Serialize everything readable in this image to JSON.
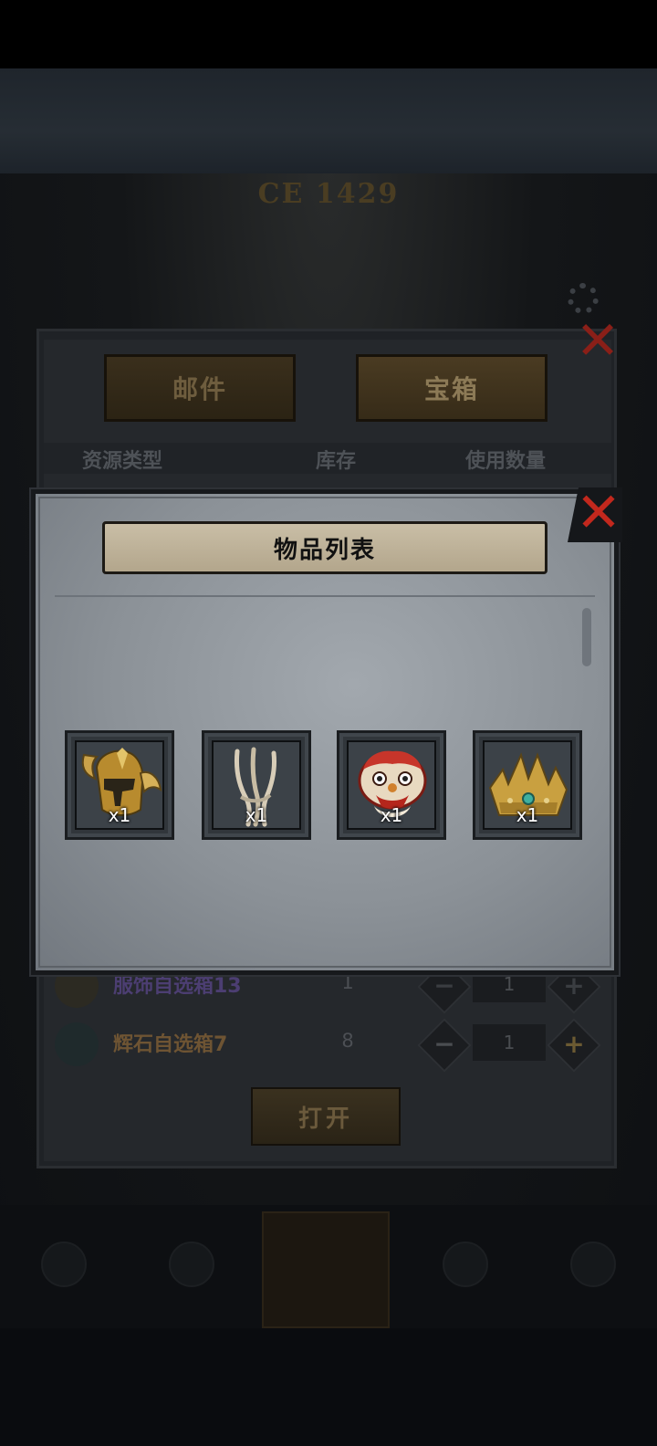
{
  "background": {
    "ce_text": "CE 1429"
  },
  "panel": {
    "tabs": [
      {
        "label": "邮件",
        "active": false
      },
      {
        "label": "宝箱",
        "active": true
      }
    ],
    "columns": [
      "资源类型",
      "库存",
      "使用数量"
    ],
    "rows": [
      {
        "name": "服饰自选箱13",
        "stock": "1",
        "qty": "1",
        "name_color": "#4c3e72",
        "icon": "clothes-box-icon"
      },
      {
        "name": "辉石自选箱7",
        "stock": "8",
        "qty": "1",
        "name_color": "#6e5433",
        "icon": "serpent-gem-icon"
      }
    ],
    "open_label": "打开"
  },
  "modal": {
    "title": "物品列表",
    "items": [
      {
        "icon": "golden-winged-helmet-icon",
        "count": "x1"
      },
      {
        "icon": "bone-claw-icon",
        "count": "x1"
      },
      {
        "icon": "lion-dance-head-icon",
        "count": "x1"
      },
      {
        "icon": "gold-crown-icon",
        "count": "x1"
      }
    ]
  },
  "colors": {
    "close_red": "#c2281d",
    "title_bar": "#c9bea6",
    "modal_bg": "#8b9197"
  }
}
